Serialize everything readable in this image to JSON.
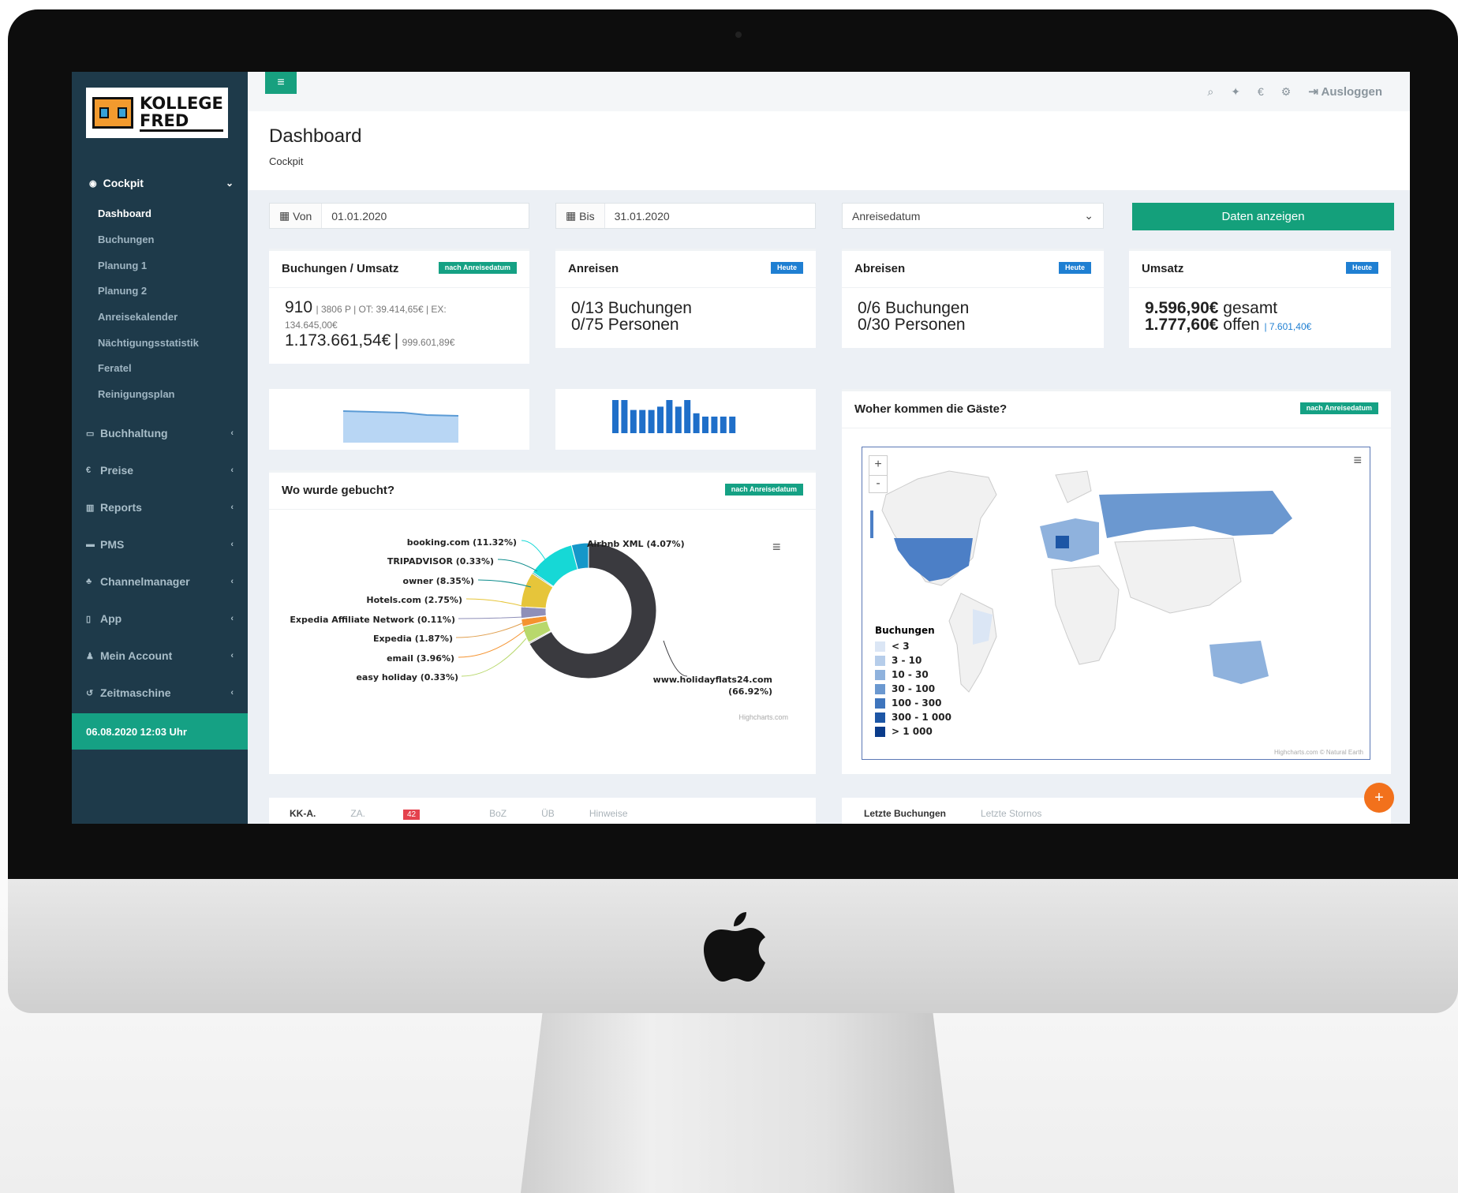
{
  "brand": {
    "line1": "KOLLEGE",
    "line2": "FRED"
  },
  "sidebar": {
    "section": "Cockpit",
    "subitems": [
      "Dashboard",
      "Buchungen",
      "Planung 1",
      "Planung 2",
      "Anreisekalender",
      "Nächtigungsstatistik",
      "Feratel",
      "Reinigungsplan"
    ],
    "menus": [
      "Buchhaltung",
      "Preise",
      "Reports",
      "PMS",
      "Channelmanager",
      "App",
      "Mein Account",
      "Zeitmaschine"
    ],
    "datetime": "06.08.2020 12:03 Uhr"
  },
  "topbar": {
    "logout": "Ausloggen",
    "menu_glyph": "≡",
    "icons": [
      "search-icon",
      "pin-icon",
      "euro-icon",
      "gear-icon",
      "logout-icon"
    ]
  },
  "header": {
    "title": "Dashboard",
    "breadcrumb": "Cockpit"
  },
  "filters": {
    "from_label": "Von",
    "from_value": "01.01.2020",
    "to_label": "Bis",
    "to_value": "31.01.2020",
    "select_value": "Anreisedatum",
    "button": "Daten anzeigen"
  },
  "cards": {
    "bookings": {
      "title": "Buchungen / Umsatz",
      "badge": "nach Anreisedatum",
      "count": "910",
      "detail1": "| 3806 P | OT: 39.414,65€ | EX:",
      "detail2": "134.645,00€",
      "total": "1.173.661,54€",
      "total_sep": "|",
      "total_small": "999.601,89€"
    },
    "arrivals": {
      "title": "Anreisen",
      "badge": "Heute",
      "line1": "0/13 Buchungen",
      "line2": "0/75 Personen"
    },
    "departures": {
      "title": "Abreisen",
      "badge": "Heute",
      "line1": "0/6 Buchungen",
      "line2": "0/30 Personen"
    },
    "revenue": {
      "title": "Umsatz",
      "badge": "Heute",
      "amount1": "9.596,90€",
      "label1": "gesamt",
      "amount2": "1.777,60€",
      "label2": "offen",
      "extra": "| 7.601,40€"
    }
  },
  "sparkline_bars": [
    100,
    100,
    70,
    70,
    70,
    80,
    100,
    80,
    100,
    60,
    50,
    50,
    50,
    50
  ],
  "pie": {
    "title": "Wo wurde gebucht?",
    "badge": "nach Anreisedatum",
    "credit": "Highcharts.com",
    "colors": [
      "#3a3a3f",
      "#1597c9",
      "#16d8d6",
      "#0c8c8c",
      "#e6c53a",
      "#8f8fb8",
      "#e0a050",
      "#f5932f",
      "#b8d86c"
    ],
    "chart_data": {
      "type": "pie",
      "slices": [
        {
          "label": "www.holidayflats24.com",
          "value": 66.92
        },
        {
          "label": "Airbnb XML",
          "value": 4.07
        },
        {
          "label": "booking.com",
          "value": 11.32
        },
        {
          "label": "TRIPADVISOR",
          "value": 0.33
        },
        {
          "label": "owner",
          "value": 8.35
        },
        {
          "label": "Hotels.com",
          "value": 2.75
        },
        {
          "label": "Expedia Affiliate Network",
          "value": 0.11
        },
        {
          "label": "Expedia",
          "value": 1.87
        },
        {
          "label": "email",
          "value": 3.96
        },
        {
          "label": "easy holiday",
          "value": 0.33
        }
      ]
    },
    "label_texts": [
      "www.holidayflats24.com",
      "(66.92%)",
      "Airbnb XML (4.07%)",
      "booking.com  (11.32%)",
      "TRIPADVISOR (0.33%)",
      "owner (8.35%)",
      "Hotels.com (2.75%)",
      "Expedia Affiliate Network (0.11%)",
      "Expedia (1.87%)",
      "email (3.96%)",
      "easy holiday (0.33%)"
    ]
  },
  "map": {
    "title": "Woher kommen die Gäste?",
    "badge": "nach Anreisedatum",
    "legend_title": "Buchungen",
    "legend": [
      "< 3",
      "3 - 10",
      "10 - 30",
      "30 - 100",
      "100 - 300",
      "300 - 1 000",
      "> 1 000"
    ],
    "legend_colors": [
      "#dbe6f5",
      "#b6cdea",
      "#8fb2dd",
      "#6b98d0",
      "#3e75bd",
      "#1d56a5",
      "#0a3b8a"
    ],
    "zoom_in": "+",
    "zoom_out": "-",
    "credit": "Highcharts.com © Natural Earth"
  },
  "tabs_left": {
    "items": [
      "KK-A.",
      "ZA.",
      "BoZ",
      "ÜB",
      "Hinweise"
    ],
    "za_count": "42"
  },
  "tabs_right": {
    "items": [
      "Letzte Buchungen",
      "Letzte Stornos"
    ]
  },
  "fab": "+"
}
